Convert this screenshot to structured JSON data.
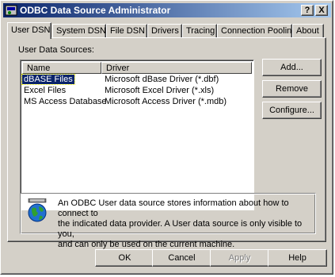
{
  "window": {
    "title": "ODBC Data Source Administrator",
    "help_glyph": "?",
    "close_glyph": "X"
  },
  "tabs": [
    {
      "label": "User DSN",
      "active": true
    },
    {
      "label": "System DSN"
    },
    {
      "label": "File DSN"
    },
    {
      "label": "Drivers"
    },
    {
      "label": "Tracing"
    },
    {
      "label": "Connection Pooling"
    },
    {
      "label": "About"
    }
  ],
  "panel": {
    "list_label": "User Data Sources:",
    "columns": [
      "Name",
      "Driver"
    ],
    "rows": [
      {
        "name": "dBASE Files",
        "driver": "Microsoft dBase Driver (*.dbf)",
        "selected": true
      },
      {
        "name": "Excel Files",
        "driver": "Microsoft Excel Driver (*.xls)"
      },
      {
        "name": "MS Access Database",
        "driver": "Microsoft Access Driver (*.mdb)"
      }
    ],
    "buttons": {
      "add": "Add...",
      "remove": "Remove",
      "configure": "Configure..."
    },
    "info": {
      "icon": "odbc-globe-icon",
      "line1": "An ODBC User data source stores information about how to connect to",
      "line2": "the indicated data provider.   A User data source is only visible to you,",
      "line3": "and can only be used on the current machine."
    }
  },
  "footer": {
    "ok": "OK",
    "cancel": "Cancel",
    "apply": "Apply",
    "help": "Help"
  },
  "colors": {
    "face": "#d4d0c8",
    "title_start": "#0a246a",
    "title_end": "#a6caf0",
    "selection": "#0a246a"
  }
}
